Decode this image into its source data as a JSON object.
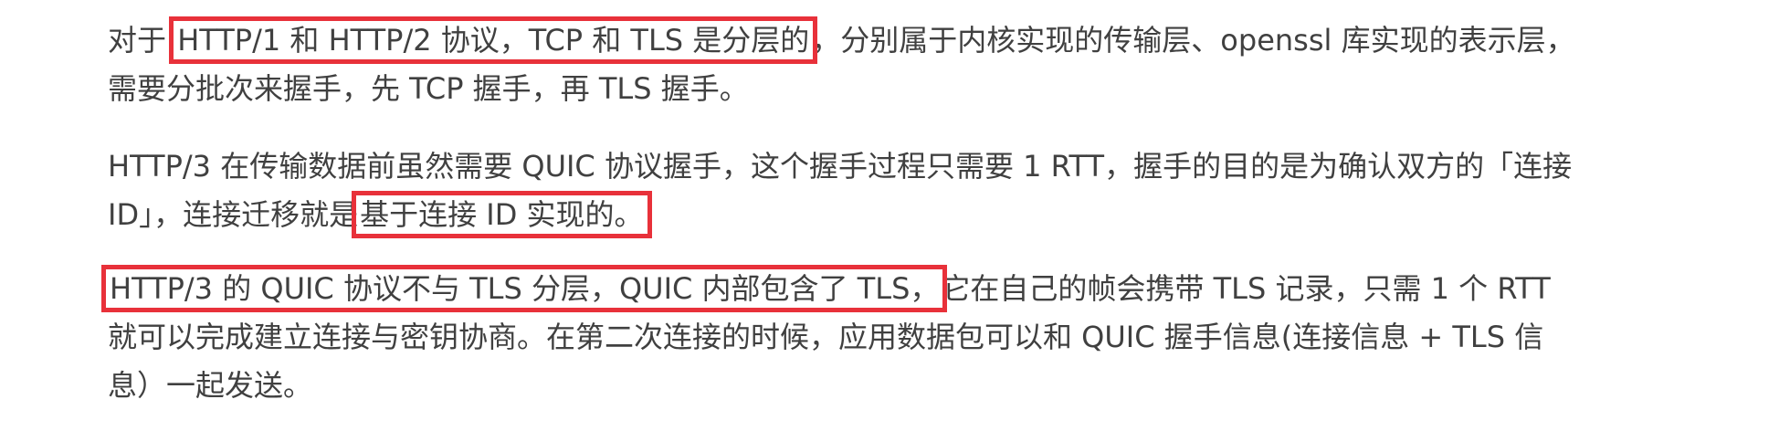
{
  "paragraphs": [
    {
      "pre": "对于 ",
      "highlight": "HTTP/1 和 HTTP/2 协议，TCP 和 TLS 是分层的",
      "post": "，分别属于内核实现的传输层、openssl 库实现的表示层，需要分批次来握手，先 TCP 握手，再 TLS 握手。"
    },
    {
      "pre": "HTTP/3 在传输数据前虽然需要 QUIC 协议握手，这个握手过程只需要 1 RTT，握手的目的是为确认双方的「连接 ID」，连接迁移就是",
      "highlight": "基于连接 ID 实现的。",
      "post": ""
    },
    {
      "pre": "",
      "highlight": "HTTP/3 的 QUIC 协议不与 TLS 分层，QUIC 内部包含了 TLS，",
      "post": "它在自己的帧会携带 TLS 记录，只需 1 个 RTT 就可以完成建立连接与密钥协商。在第二次连接的时候，应用数据包可以和 QUIC 握手信息(连接信息 + TLS 信息）一起发送。"
    }
  ],
  "colors": {
    "text": "#404040",
    "highlight_border": "#e8313a",
    "background": "#ffffff"
  }
}
